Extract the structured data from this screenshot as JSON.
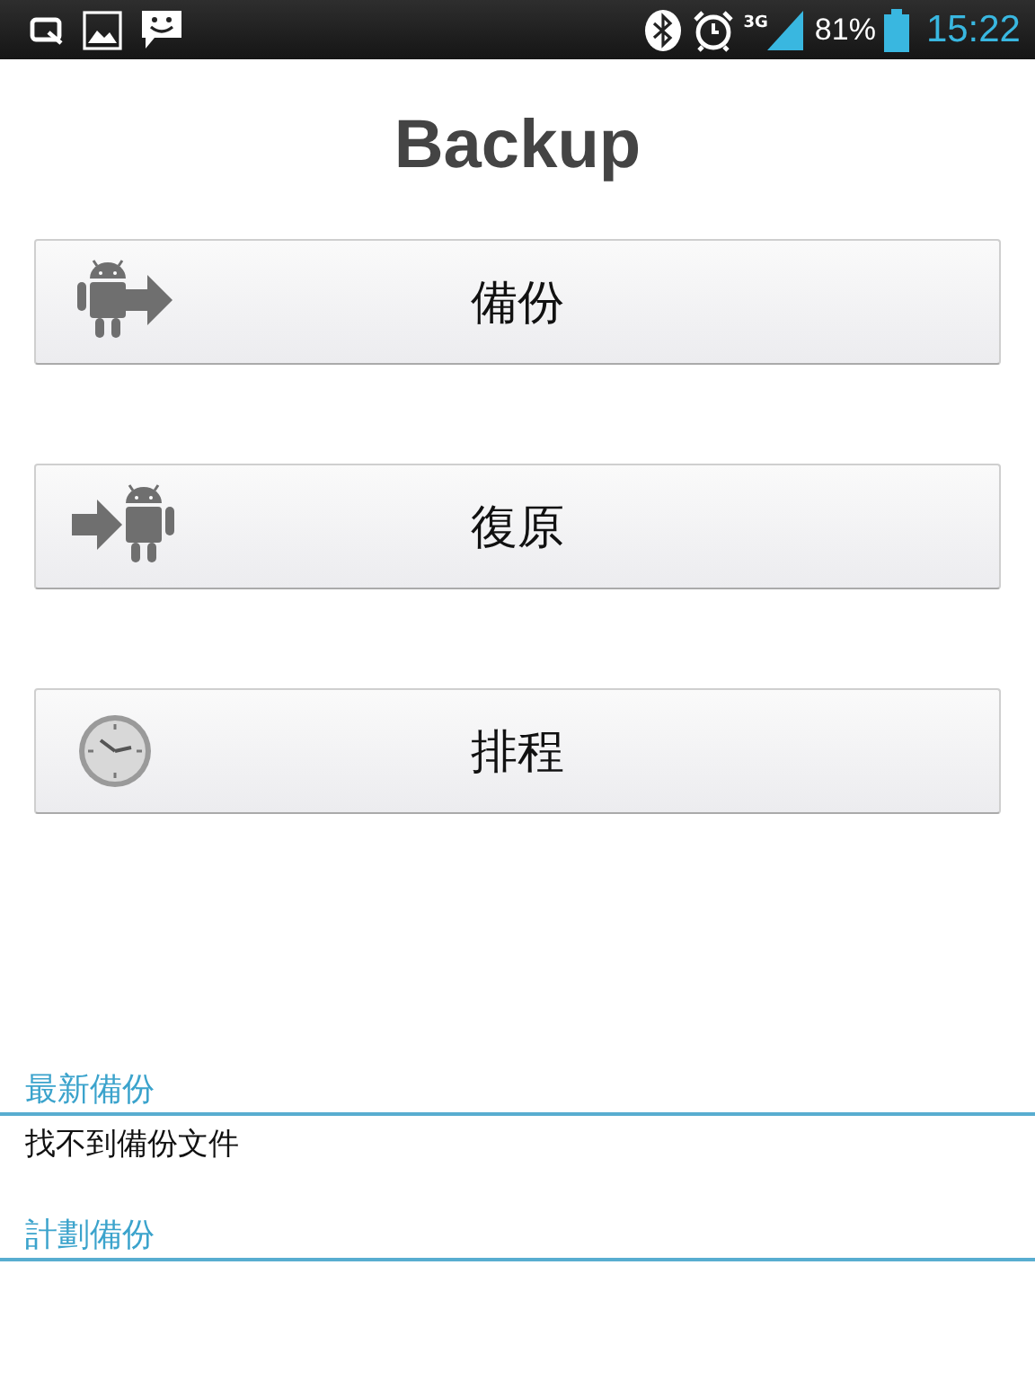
{
  "status_bar": {
    "battery": "81%",
    "time": "15:22",
    "network": "3G"
  },
  "title": "Backup",
  "actions": [
    {
      "kind": "backup",
      "label": "備份"
    },
    {
      "kind": "restore",
      "label": "復原"
    },
    {
      "kind": "schedule",
      "label": "排程"
    }
  ],
  "sections": [
    {
      "header": "最新備份",
      "text": "找不到備份文件"
    },
    {
      "header": "計劃備份"
    }
  ]
}
